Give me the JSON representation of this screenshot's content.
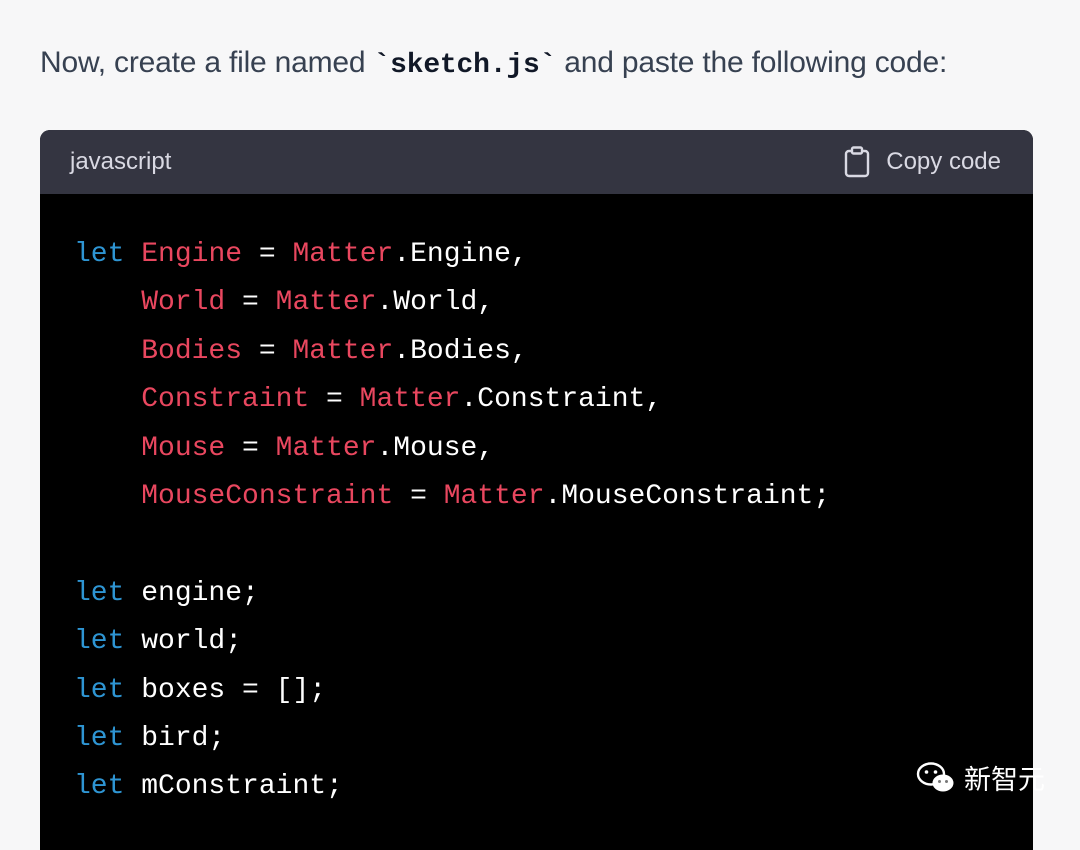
{
  "intro": {
    "before": "Now, create a file named ",
    "code": "`sketch.js`",
    "after": " and paste the following code:"
  },
  "code_block": {
    "language": "javascript",
    "copy_label": "Copy code",
    "lines": [
      [
        {
          "t": "let",
          "c": "kw"
        },
        {
          "t": " ",
          "c": "plain"
        },
        {
          "t": "Engine",
          "c": "var"
        },
        {
          "t": " = ",
          "c": "plain"
        },
        {
          "t": "Matter",
          "c": "var"
        },
        {
          "t": ".Engine,",
          "c": "plain"
        }
      ],
      [
        {
          "t": "    ",
          "c": "plain"
        },
        {
          "t": "World",
          "c": "var"
        },
        {
          "t": " = ",
          "c": "plain"
        },
        {
          "t": "Matter",
          "c": "var"
        },
        {
          "t": ".World,",
          "c": "plain"
        }
      ],
      [
        {
          "t": "    ",
          "c": "plain"
        },
        {
          "t": "Bodies",
          "c": "var"
        },
        {
          "t": " = ",
          "c": "plain"
        },
        {
          "t": "Matter",
          "c": "var"
        },
        {
          "t": ".Bodies,",
          "c": "plain"
        }
      ],
      [
        {
          "t": "    ",
          "c": "plain"
        },
        {
          "t": "Constraint",
          "c": "var"
        },
        {
          "t": " = ",
          "c": "plain"
        },
        {
          "t": "Matter",
          "c": "var"
        },
        {
          "t": ".Constraint,",
          "c": "plain"
        }
      ],
      [
        {
          "t": "    ",
          "c": "plain"
        },
        {
          "t": "Mouse",
          "c": "var"
        },
        {
          "t": " = ",
          "c": "plain"
        },
        {
          "t": "Matter",
          "c": "var"
        },
        {
          "t": ".Mouse,",
          "c": "plain"
        }
      ],
      [
        {
          "t": "    ",
          "c": "plain"
        },
        {
          "t": "MouseConstraint",
          "c": "var"
        },
        {
          "t": " = ",
          "c": "plain"
        },
        {
          "t": "Matter",
          "c": "var"
        },
        {
          "t": ".MouseConstraint;",
          "c": "plain"
        }
      ],
      [],
      [
        {
          "t": "let",
          "c": "kw"
        },
        {
          "t": " engine;",
          "c": "plain"
        }
      ],
      [
        {
          "t": "let",
          "c": "kw"
        },
        {
          "t": " world;",
          "c": "plain"
        }
      ],
      [
        {
          "t": "let",
          "c": "kw"
        },
        {
          "t": " boxes = [];",
          "c": "plain"
        }
      ],
      [
        {
          "t": "let",
          "c": "kw"
        },
        {
          "t": " bird;",
          "c": "plain"
        }
      ],
      [
        {
          "t": "let",
          "c": "kw"
        },
        {
          "t": " mConstraint;",
          "c": "plain"
        }
      ]
    ]
  },
  "watermark": {
    "text": "新智元",
    "icon": "wechat-icon"
  }
}
